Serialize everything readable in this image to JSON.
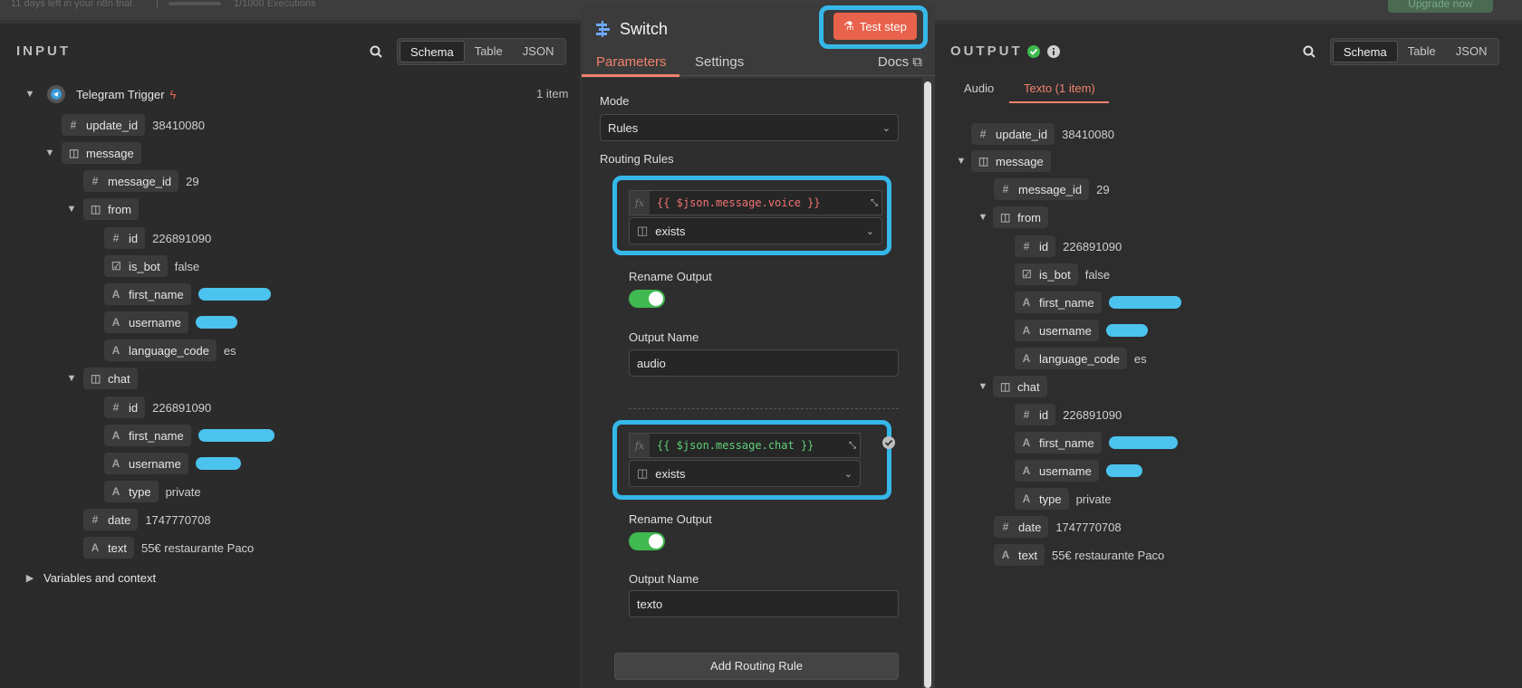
{
  "topbar": {
    "trial_text": "11 days left in your n8n trial",
    "separator": "|",
    "executions": "1/1000 Executions",
    "upgrade_label": "Upgrade now"
  },
  "input": {
    "title": "INPUT",
    "view_tabs": [
      "Schema",
      "Table",
      "JSON"
    ],
    "active_view": "Schema",
    "node_name": "Telegram Trigger",
    "item_count": "1 item",
    "fields": {
      "update_id": {
        "key": "update_id",
        "value": "38410080"
      },
      "message": {
        "key": "message"
      },
      "message_id": {
        "key": "message_id",
        "value": "29"
      },
      "from": {
        "key": "from"
      },
      "from_id": {
        "key": "id",
        "value": "226891090"
      },
      "is_bot": {
        "key": "is_bot",
        "value": "false"
      },
      "first_name": {
        "key": "first_name"
      },
      "username": {
        "key": "username"
      },
      "language_code": {
        "key": "language_code",
        "value": "es"
      },
      "chat": {
        "key": "chat"
      },
      "chat_id": {
        "key": "id",
        "value": "226891090"
      },
      "chat_first_name": {
        "key": "first_name"
      },
      "chat_username": {
        "key": "username"
      },
      "type": {
        "key": "type",
        "value": "private"
      },
      "date": {
        "key": "date",
        "value": "1747770708"
      },
      "text": {
        "key": "text",
        "value": "55€ restaurante Paco"
      }
    },
    "variables_label": "Variables and context"
  },
  "node": {
    "title": "Switch",
    "test_label": "Test step",
    "tabs": [
      "Parameters",
      "Settings"
    ],
    "docs_label": "Docs",
    "mode_label": "Mode",
    "mode_value": "Rules",
    "routing_label": "Routing Rules",
    "rules": [
      {
        "expression": "{{ $json.message.voice }}",
        "operator": "exists",
        "rename_label": "Rename Output",
        "output_name_label": "Output Name",
        "output_name": "audio"
      },
      {
        "expression": "{{ $json.message.chat }}",
        "operator": "exists",
        "rename_label": "Rename Output",
        "output_name_label": "Output Name",
        "output_name": "texto"
      }
    ],
    "add_rule_label": "Add Routing Rule"
  },
  "output": {
    "title": "OUTPUT",
    "view_tabs": [
      "Schema",
      "Table",
      "JSON"
    ],
    "active_view": "Schema",
    "branch_tabs": [
      "Audio",
      "Texto (1 item)"
    ],
    "active_branch": "Texto (1 item)"
  },
  "colors": {
    "accent": "#f0826e",
    "highlight": "#35b8e9",
    "success": "#3fb950",
    "redaction": "#4cc3ef"
  }
}
